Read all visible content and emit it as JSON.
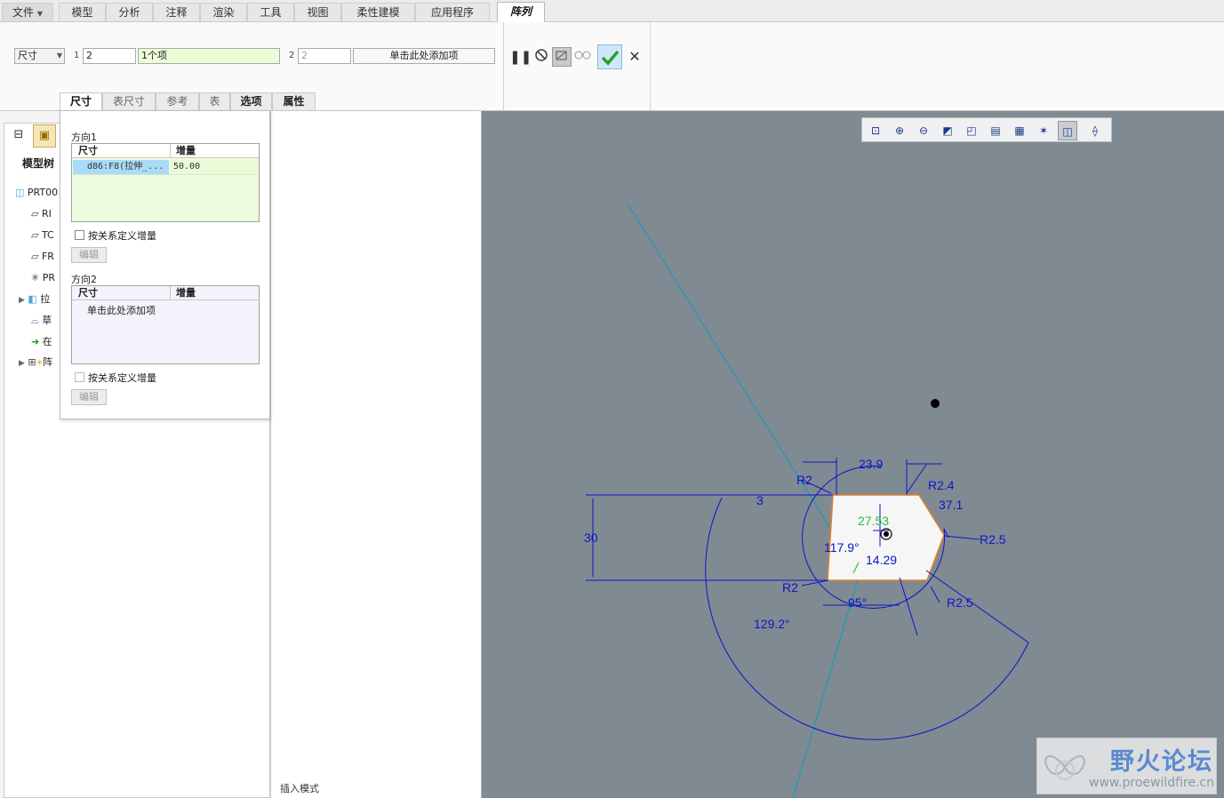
{
  "menu": {
    "file": "文件",
    "tabs": [
      "模型",
      "分析",
      "注释",
      "渲染",
      "工具",
      "视图",
      "柔性建模",
      "应用程序"
    ],
    "active": "阵列"
  },
  "ribbon": {
    "type_select": "尺寸",
    "dir1_num": "1",
    "dir1_count": "2",
    "dir1_items": "1个项",
    "dir2_num": "2",
    "dir2_count": "2",
    "dir2_add": "单击此处添加项"
  },
  "subtabs": [
    "尺寸",
    "表尺寸",
    "参考",
    "表",
    "选项",
    "属性"
  ],
  "panel": {
    "dir1_label": "方向1",
    "col_dim": "尺寸",
    "col_inc": "增量",
    "row1_dim": "d86:F8(拉伸_...",
    "row1_inc": "50.00",
    "relation": "按关系定义增量",
    "edit": "编辑",
    "dir2_label": "方向2",
    "dir2_add": "单击此处添加项"
  },
  "tree": {
    "tab": "模型树",
    "items": [
      "PRT00",
      "RI",
      "TC",
      "FR",
      "PR",
      "拉",
      "草",
      "在",
      "阵"
    ]
  },
  "status": "插入模式",
  "sketch": {
    "dims": [
      "23.9",
      "R2",
      "R2.4",
      "3",
      "37.1",
      "27.53",
      "30",
      "117.9°",
      "14.29",
      "R2.5",
      "R2",
      "95°",
      "R2.5",
      "129.2°"
    ]
  },
  "watermark": {
    "title": "野火论坛",
    "url": "www.proewildfire.cn"
  },
  "colors": {
    "graphics_bg": "#808a92",
    "dim_blue": "#0d16c8",
    "green": "#21c24a",
    "cyan_axis": "#1a9ac0",
    "accent_check": "#2aa02a"
  }
}
